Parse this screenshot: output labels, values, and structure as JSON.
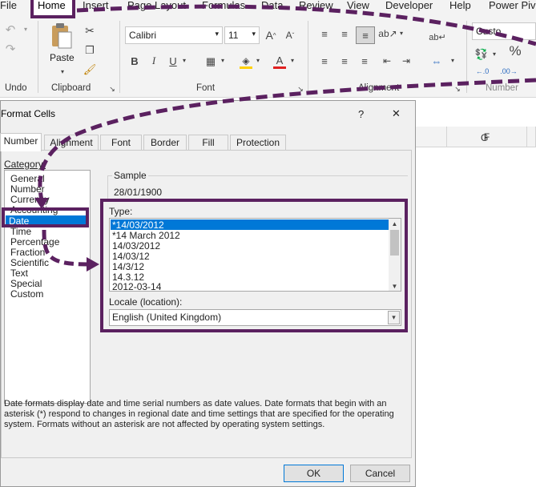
{
  "menu": {
    "items": [
      "File",
      "Home",
      "Insert",
      "Page Layout",
      "Formulas",
      "Data",
      "Review",
      "View",
      "Developer",
      "Help",
      "Power Piv"
    ]
  },
  "ribbon": {
    "undo_group": "Undo",
    "clipboard_group": "Clipboard",
    "paste_label": "Paste",
    "font_group": "Font",
    "font_name": "Calibri",
    "font_size": "11",
    "alignment_group": "Alignment",
    "number_group": "Number",
    "number_format": "Custo"
  },
  "sheet": {
    "columns": [
      "F",
      "G"
    ]
  },
  "dialog": {
    "title": "Format Cells",
    "help": "?",
    "close": "✕",
    "tabs": [
      "Number",
      "Alignment",
      "Font",
      "Border",
      "Fill",
      "Protection"
    ],
    "category_label": "Category:",
    "categories": [
      "General",
      "Number",
      "Currency",
      "Accounting",
      "Date",
      "Time",
      "Percentage",
      "Fraction",
      "Scientific",
      "Text",
      "Special",
      "Custom"
    ],
    "selected_category": "Date",
    "sample_label": "Sample",
    "sample_value": "28/01/1900",
    "type_label": "Type:",
    "types": [
      "*14/03/2012",
      "*14 March 2012",
      "14/03/2012",
      "14/03/12",
      "14/3/12",
      "14.3.12",
      "2012-03-14"
    ],
    "locale_label": "Locale (location):",
    "locale_value": "English (United Kingdom)",
    "description": "Date formats display date and time serial numbers as date values.  Date formats that begin with an asterisk (*) respond to changes in regional date and time settings that are specified for the operating system. Formats without an asterisk are not affected by operating system settings.",
    "ok": "OK",
    "cancel": "Cancel"
  },
  "colors": {
    "annotation": "#5b2160",
    "selection": "#0078d7"
  }
}
